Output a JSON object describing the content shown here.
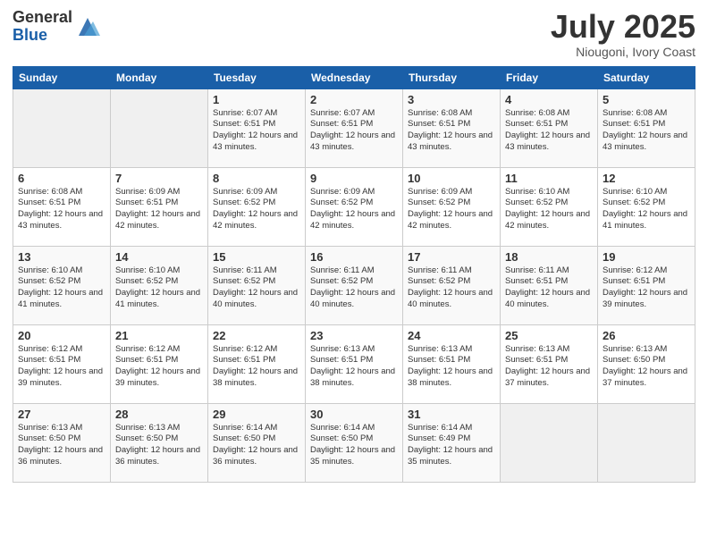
{
  "header": {
    "logo_general": "General",
    "logo_blue": "Blue",
    "month": "July 2025",
    "location": "Niougoni, Ivory Coast"
  },
  "days_of_week": [
    "Sunday",
    "Monday",
    "Tuesday",
    "Wednesday",
    "Thursday",
    "Friday",
    "Saturday"
  ],
  "weeks": [
    [
      {
        "day": "",
        "sunrise": "",
        "sunset": "",
        "daylight": "",
        "empty": true
      },
      {
        "day": "",
        "sunrise": "",
        "sunset": "",
        "daylight": "",
        "empty": true
      },
      {
        "day": "1",
        "sunrise": "Sunrise: 6:07 AM",
        "sunset": "Sunset: 6:51 PM",
        "daylight": "Daylight: 12 hours and 43 minutes."
      },
      {
        "day": "2",
        "sunrise": "Sunrise: 6:07 AM",
        "sunset": "Sunset: 6:51 PM",
        "daylight": "Daylight: 12 hours and 43 minutes."
      },
      {
        "day": "3",
        "sunrise": "Sunrise: 6:08 AM",
        "sunset": "Sunset: 6:51 PM",
        "daylight": "Daylight: 12 hours and 43 minutes."
      },
      {
        "day": "4",
        "sunrise": "Sunrise: 6:08 AM",
        "sunset": "Sunset: 6:51 PM",
        "daylight": "Daylight: 12 hours and 43 minutes."
      },
      {
        "day": "5",
        "sunrise": "Sunrise: 6:08 AM",
        "sunset": "Sunset: 6:51 PM",
        "daylight": "Daylight: 12 hours and 43 minutes."
      }
    ],
    [
      {
        "day": "6",
        "sunrise": "Sunrise: 6:08 AM",
        "sunset": "Sunset: 6:51 PM",
        "daylight": "Daylight: 12 hours and 43 minutes."
      },
      {
        "day": "7",
        "sunrise": "Sunrise: 6:09 AM",
        "sunset": "Sunset: 6:51 PM",
        "daylight": "Daylight: 12 hours and 42 minutes."
      },
      {
        "day": "8",
        "sunrise": "Sunrise: 6:09 AM",
        "sunset": "Sunset: 6:52 PM",
        "daylight": "Daylight: 12 hours and 42 minutes."
      },
      {
        "day": "9",
        "sunrise": "Sunrise: 6:09 AM",
        "sunset": "Sunset: 6:52 PM",
        "daylight": "Daylight: 12 hours and 42 minutes."
      },
      {
        "day": "10",
        "sunrise": "Sunrise: 6:09 AM",
        "sunset": "Sunset: 6:52 PM",
        "daylight": "Daylight: 12 hours and 42 minutes."
      },
      {
        "day": "11",
        "sunrise": "Sunrise: 6:10 AM",
        "sunset": "Sunset: 6:52 PM",
        "daylight": "Daylight: 12 hours and 42 minutes."
      },
      {
        "day": "12",
        "sunrise": "Sunrise: 6:10 AM",
        "sunset": "Sunset: 6:52 PM",
        "daylight": "Daylight: 12 hours and 41 minutes."
      }
    ],
    [
      {
        "day": "13",
        "sunrise": "Sunrise: 6:10 AM",
        "sunset": "Sunset: 6:52 PM",
        "daylight": "Daylight: 12 hours and 41 minutes."
      },
      {
        "day": "14",
        "sunrise": "Sunrise: 6:10 AM",
        "sunset": "Sunset: 6:52 PM",
        "daylight": "Daylight: 12 hours and 41 minutes."
      },
      {
        "day": "15",
        "sunrise": "Sunrise: 6:11 AM",
        "sunset": "Sunset: 6:52 PM",
        "daylight": "Daylight: 12 hours and 40 minutes."
      },
      {
        "day": "16",
        "sunrise": "Sunrise: 6:11 AM",
        "sunset": "Sunset: 6:52 PM",
        "daylight": "Daylight: 12 hours and 40 minutes."
      },
      {
        "day": "17",
        "sunrise": "Sunrise: 6:11 AM",
        "sunset": "Sunset: 6:52 PM",
        "daylight": "Daylight: 12 hours and 40 minutes."
      },
      {
        "day": "18",
        "sunrise": "Sunrise: 6:11 AM",
        "sunset": "Sunset: 6:51 PM",
        "daylight": "Daylight: 12 hours and 40 minutes."
      },
      {
        "day": "19",
        "sunrise": "Sunrise: 6:12 AM",
        "sunset": "Sunset: 6:51 PM",
        "daylight": "Daylight: 12 hours and 39 minutes."
      }
    ],
    [
      {
        "day": "20",
        "sunrise": "Sunrise: 6:12 AM",
        "sunset": "Sunset: 6:51 PM",
        "daylight": "Daylight: 12 hours and 39 minutes."
      },
      {
        "day": "21",
        "sunrise": "Sunrise: 6:12 AM",
        "sunset": "Sunset: 6:51 PM",
        "daylight": "Daylight: 12 hours and 39 minutes."
      },
      {
        "day": "22",
        "sunrise": "Sunrise: 6:12 AM",
        "sunset": "Sunset: 6:51 PM",
        "daylight": "Daylight: 12 hours and 38 minutes."
      },
      {
        "day": "23",
        "sunrise": "Sunrise: 6:13 AM",
        "sunset": "Sunset: 6:51 PM",
        "daylight": "Daylight: 12 hours and 38 minutes."
      },
      {
        "day": "24",
        "sunrise": "Sunrise: 6:13 AM",
        "sunset": "Sunset: 6:51 PM",
        "daylight": "Daylight: 12 hours and 38 minutes."
      },
      {
        "day": "25",
        "sunrise": "Sunrise: 6:13 AM",
        "sunset": "Sunset: 6:51 PM",
        "daylight": "Daylight: 12 hours and 37 minutes."
      },
      {
        "day": "26",
        "sunrise": "Sunrise: 6:13 AM",
        "sunset": "Sunset: 6:50 PM",
        "daylight": "Daylight: 12 hours and 37 minutes."
      }
    ],
    [
      {
        "day": "27",
        "sunrise": "Sunrise: 6:13 AM",
        "sunset": "Sunset: 6:50 PM",
        "daylight": "Daylight: 12 hours and 36 minutes."
      },
      {
        "day": "28",
        "sunrise": "Sunrise: 6:13 AM",
        "sunset": "Sunset: 6:50 PM",
        "daylight": "Daylight: 12 hours and 36 minutes."
      },
      {
        "day": "29",
        "sunrise": "Sunrise: 6:14 AM",
        "sunset": "Sunset: 6:50 PM",
        "daylight": "Daylight: 12 hours and 36 minutes."
      },
      {
        "day": "30",
        "sunrise": "Sunrise: 6:14 AM",
        "sunset": "Sunset: 6:50 PM",
        "daylight": "Daylight: 12 hours and 35 minutes."
      },
      {
        "day": "31",
        "sunrise": "Sunrise: 6:14 AM",
        "sunset": "Sunset: 6:49 PM",
        "daylight": "Daylight: 12 hours and 35 minutes."
      },
      {
        "day": "",
        "sunrise": "",
        "sunset": "",
        "daylight": "",
        "empty": true
      },
      {
        "day": "",
        "sunrise": "",
        "sunset": "",
        "daylight": "",
        "empty": true
      }
    ]
  ]
}
